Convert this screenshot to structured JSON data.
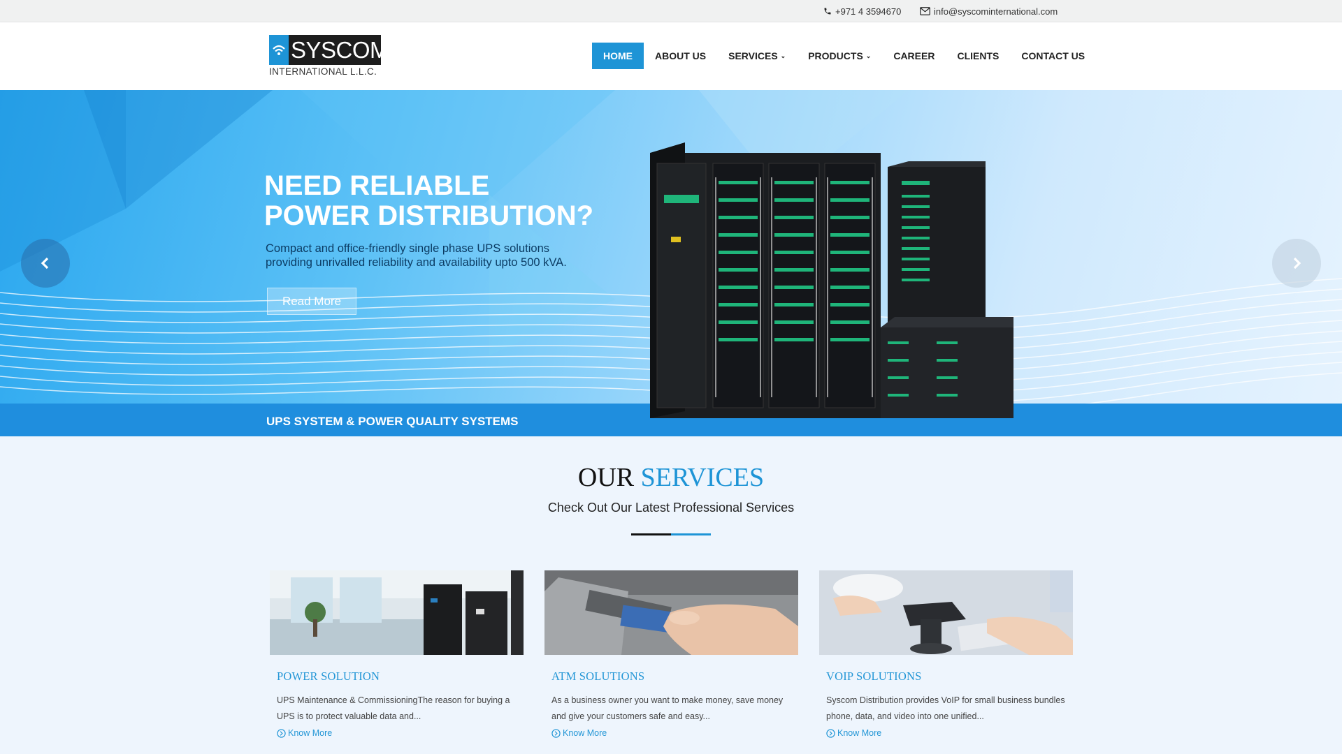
{
  "topbar": {
    "phone": "+971 4 3594670",
    "email": "info@syscominternational.com",
    "phone_icon": "phone-icon",
    "email_icon": "envelope-icon"
  },
  "logo": {
    "word": "SYSCOM",
    "subtitle": "INTERNATIONAL L.L.C."
  },
  "nav": {
    "items": [
      {
        "label": "HOME",
        "active": true
      },
      {
        "label": "ABOUT US"
      },
      {
        "label": "SERVICES",
        "dropdown": true
      },
      {
        "label": "PRODUCTS",
        "dropdown": true
      },
      {
        "label": "CAREER"
      },
      {
        "label": "CLIENTS"
      },
      {
        "label": "CONTACT US"
      }
    ]
  },
  "hero": {
    "title_line1": "NEED RELIABLE",
    "title_line2": "POWER DISTRIBUTION?",
    "subtitle_line1": "Compact and office-friendly single phase UPS solutions",
    "subtitle_line2": "providing unrivalled reliability and availability upto 500 kVA.",
    "button": "Read More",
    "band": "UPS SYSTEM & POWER QUALITY SYSTEMS"
  },
  "services": {
    "title_a": "OUR",
    "title_b": "SERVICES",
    "subtitle": "Check Out Our Latest Professional Services",
    "cards": [
      {
        "title": "POWER SOLUTION",
        "text": "UPS Maintenance & CommissioningThe reason for buying a UPS is to protect valuable data and...",
        "more": "Know More"
      },
      {
        "title": "ATM SOLUTIONS",
        "text": "As a business owner you want to make money, save money and give your customers safe and easy...",
        "more": "Know More"
      },
      {
        "title": "VOIP SOLUTIONS",
        "text": "Syscom Distribution provides VoIP for small business bundles phone, data, and video into one unified...",
        "more": "Know More"
      }
    ]
  },
  "colors": {
    "accent": "#1e94d6",
    "band": "#1f8ede",
    "topbar": "#f0f1f1"
  }
}
